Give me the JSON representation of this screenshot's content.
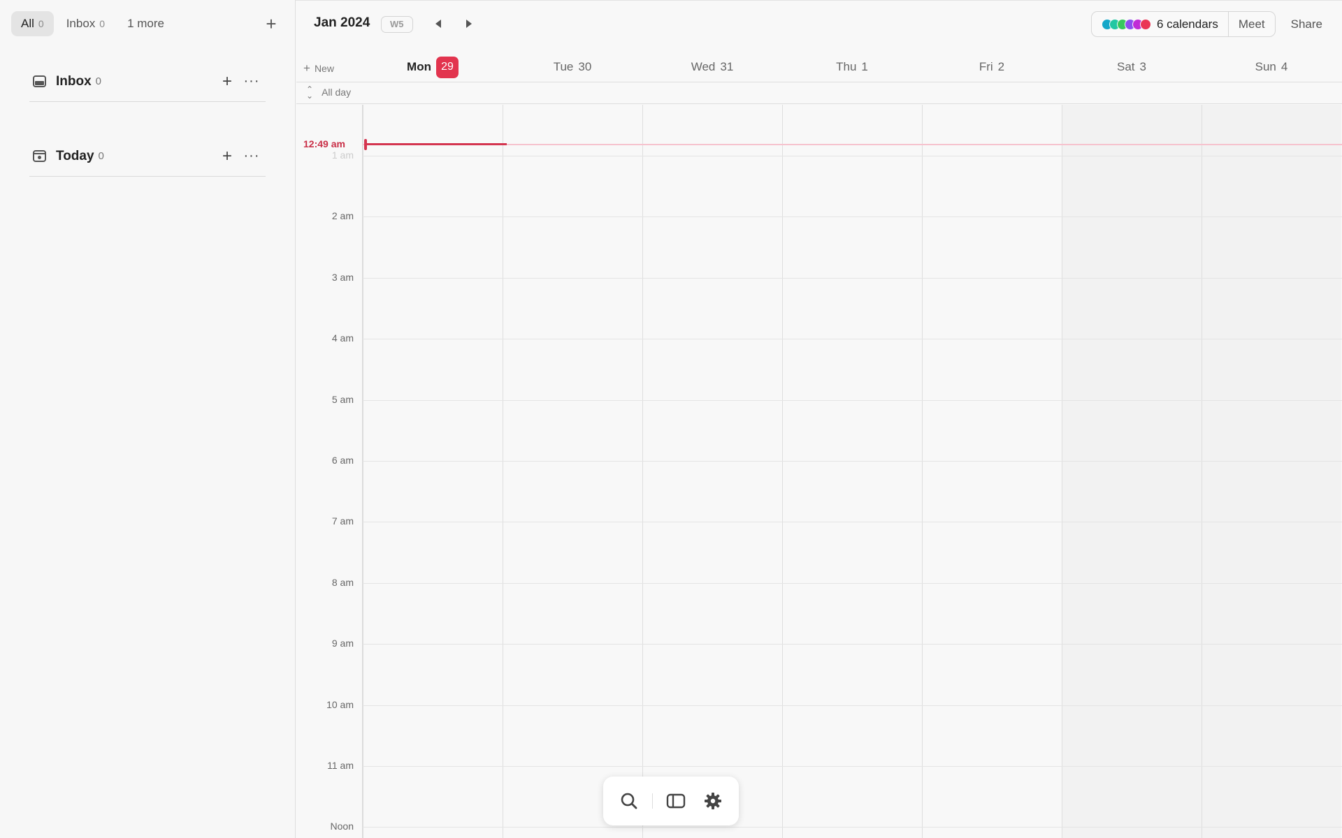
{
  "sidebar": {
    "filters": [
      {
        "label": "All",
        "count": "0"
      },
      {
        "label": "Inbox",
        "count": "0"
      },
      {
        "label": "1 more",
        "count": ""
      }
    ],
    "add_label": "+",
    "sections": [
      {
        "title": "Inbox",
        "count": "0",
        "icon": "inbox-icon"
      },
      {
        "title": "Today",
        "count": "0",
        "icon": "today-icon"
      }
    ],
    "section_add": "+",
    "section_more": "···"
  },
  "header": {
    "month": "Jan 2024",
    "week": "W5",
    "calendars_label": "6 calendars",
    "calendar_colors": [
      "#14a7c9",
      "#22c7a3",
      "#36c85f",
      "#8b4ff0",
      "#c02bd6",
      "#ea3455"
    ],
    "meet_label": "Meet",
    "share_label": "Share"
  },
  "calendar": {
    "new_label": "New",
    "new_plus": "+",
    "all_day_label": "All day",
    "collapse_icon": "⌃⌄",
    "days": [
      {
        "name": "Mon",
        "date": "29",
        "today": true
      },
      {
        "name": "Tue",
        "date": "30"
      },
      {
        "name": "Wed",
        "date": "31"
      },
      {
        "name": "Thu",
        "date": "1"
      },
      {
        "name": "Fri",
        "date": "2"
      },
      {
        "name": "Sat",
        "date": "3",
        "weekend": true
      },
      {
        "name": "Sun",
        "date": "4",
        "weekend": true
      }
    ],
    "hours": [
      "1 am",
      "2 am",
      "3 am",
      "4 am",
      "5 am",
      "6 am",
      "7 am",
      "8 am",
      "9 am",
      "10 am",
      "11 am",
      "Noon"
    ],
    "now_label": "12:49 am",
    "now_color": "#d4354f"
  },
  "toolbar": {
    "tools": [
      "search-icon",
      "sidebar-toggle-icon",
      "gear-icon"
    ]
  }
}
